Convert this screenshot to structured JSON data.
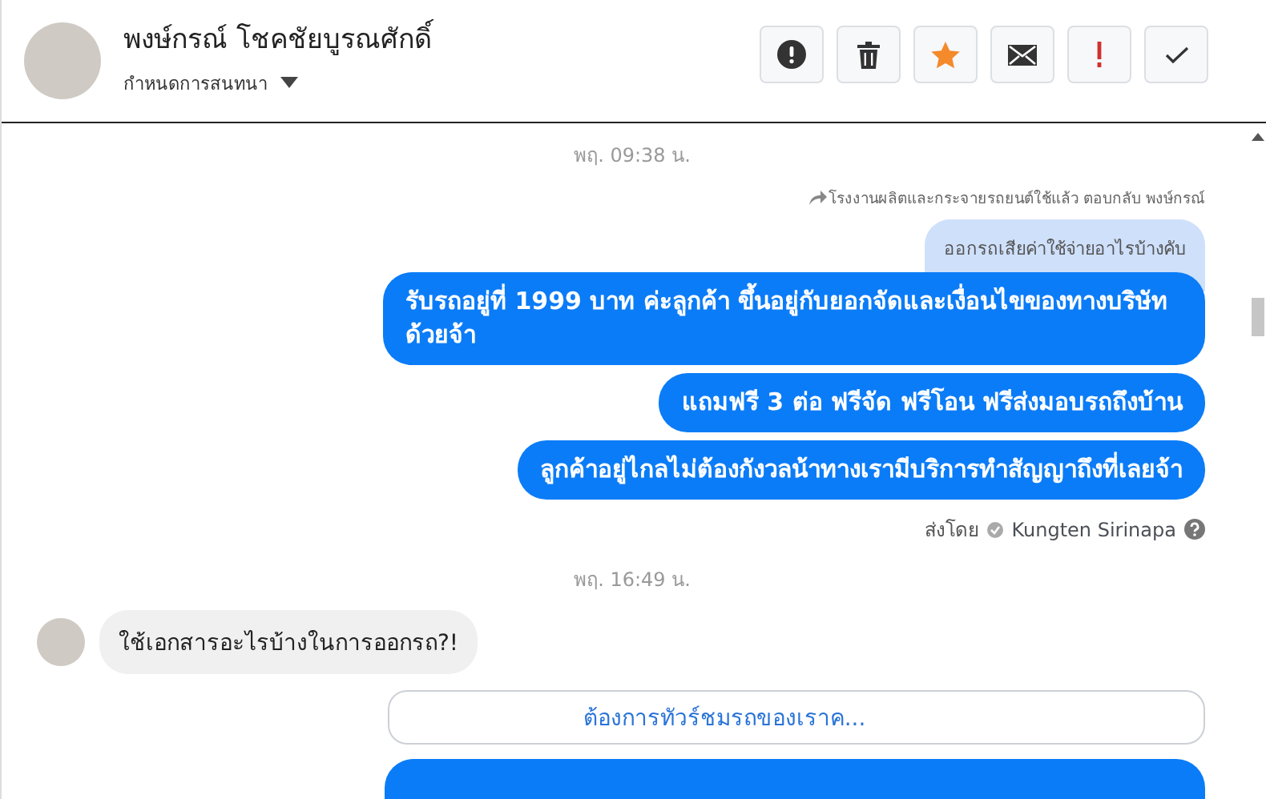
{
  "header": {
    "name": "พงษ์กรณ์ โชคชัยบูรณศักดิ์",
    "subtitle": "กำหนดการสนทนา",
    "actions": [
      {
        "kind": "alert"
      },
      {
        "kind": "trash"
      },
      {
        "kind": "star"
      },
      {
        "kind": "mail"
      },
      {
        "kind": "exclaim"
      },
      {
        "kind": "check"
      }
    ]
  },
  "messages": [
    {
      "kind": "timestamp",
      "text": "พฤ. 09:38 น."
    },
    {
      "kind": "reply_note",
      "text": "โรงงานผลิตและกระจายรถยนต์ใช้แล้ว ตอบกลับ พงษ์กรณ์"
    },
    {
      "kind": "quoted",
      "text": "ออกรถเสียค่าใช้จ่ายอาไรบ้างคับ"
    },
    {
      "kind": "outgoing",
      "text": "รับรถอยู่ที่ 1999 บาท ค่ะลูกค้า ขึ้นอยู่กับยอกจัดและเงื่อนไขของทางบริษัทด้วยจ้า"
    },
    {
      "kind": "outgoing",
      "text": "แถมฟรี 3 ต่อ ฟรีจัด ฟรีโอน  ฟรีส่งมอบรถถึงบ้าน"
    },
    {
      "kind": "outgoing",
      "text": "ลูกค้าอยู่ไกลไม่ต้องกังวลน้าทางเรามีบริการทำสัญญาถึงที่เลยจ้า"
    },
    {
      "kind": "sent_by",
      "label": "ส่งโดย",
      "sender": "Kungten Sirinapa"
    },
    {
      "kind": "timestamp",
      "text": "พฤ. 16:49 น."
    },
    {
      "kind": "incoming",
      "text": "ใช้เอกสารอะไรบ้างในการออกรถ?!"
    },
    {
      "kind": "link_card",
      "text": "ต้องการทัวร์ชมรถของเราค..."
    },
    {
      "kind": "outgoing_cut"
    }
  ]
}
